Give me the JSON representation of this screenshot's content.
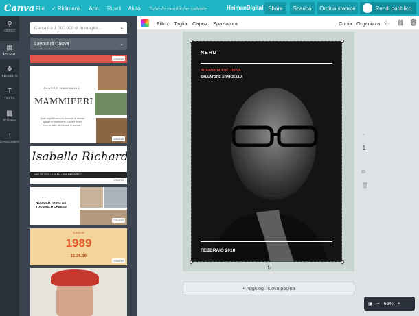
{
  "topbar": {
    "logo": "Canva",
    "menu": [
      "File",
      "✓ Ridimens.",
      "Ann.",
      "Ripeti",
      "Aiuto"
    ],
    "saved_status": "Tutte le modifiche salvate",
    "team_name": "HeimanDigital",
    "share_label": "Share",
    "download_label": "Scarica",
    "print_label": "Ordina stampe",
    "public_label": "Rendi pubblico"
  },
  "rail": {
    "items": [
      {
        "label": "CERCA",
        "icon": "search-icon",
        "glyph": "⚲"
      },
      {
        "label": "LAYOUT",
        "icon": "layout-icon",
        "glyph": "▦"
      },
      {
        "label": "ELEMENTI",
        "icon": "elements-icon",
        "glyph": "❖"
      },
      {
        "label": "TESTO",
        "icon": "text-icon",
        "glyph": "T"
      },
      {
        "label": "SFONDO",
        "icon": "background-icon",
        "glyph": "▩"
      },
      {
        "label": "CARICAMENTI",
        "icon": "upload-icon",
        "glyph": "↑"
      }
    ]
  },
  "panel": {
    "search_placeholder": "Cerca tra 1.000.000 di immagini...",
    "layout_select": "Layout di Canva",
    "free_badge": "GRATIS",
    "tiles": {
      "mammals_class": "CLASSE MAMMALIA",
      "mammals_title": "MAMMIFERI",
      "mammals_body": "Quali aspetti hanno in comune le diverse specie di mammiferi? Cosa ti rende diverso dalle altre classi di animali?",
      "name_title": "Isabella Richards",
      "name_bar": "MAY 25, 2018  •  6:30 PM  •  THE PINEAPPLE",
      "cheese_text": "NO SUCH THING AS TOO MUCH CHEESE",
      "year_sub": "CLASS OF",
      "year": "1989",
      "year_date": "11.26.16"
    }
  },
  "editor_toolbar": {
    "tools": [
      "Filtro",
      "Taglia",
      "Capov.",
      "Spaziatura"
    ],
    "copy_label": "Copia",
    "arrange_label": "Organizza"
  },
  "poster": {
    "title": "NERD",
    "kicker": "INTERVISTA ESCLUSIVA",
    "name": "SALVATORE ARANZULLA",
    "date": "FEBBRAIO 2018"
  },
  "canvas": {
    "page_number": "1",
    "add_page_label": "+ Aggiungi nuova pagina"
  },
  "zoom": {
    "value": "66%"
  },
  "colors": {
    "brand": "#1fb5c4",
    "sidebar": "#293039",
    "panel": "#3b444e",
    "accent_red": "#e2574c"
  }
}
